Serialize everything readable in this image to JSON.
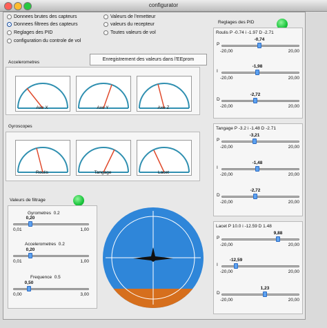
{
  "window": {
    "title": "configurator"
  },
  "modes": [
    {
      "label": "Donnees brutes des capteurs",
      "selected": false
    },
    {
      "label": "Donnees filtrees des capteurs",
      "selected": true
    },
    {
      "label": "Reglages des PID",
      "selected": false
    },
    {
      "label": "configuration du controle de vol",
      "selected": false
    }
  ],
  "modes_right": [
    {
      "label": "Valeurs de l'emetteur",
      "selected": false
    },
    {
      "label": "valeurs du recepteur",
      "selected": false
    },
    {
      "label": "Toutes valeurs de vol",
      "selected": false
    }
  ],
  "eeprom_button": "Enregistrement des valeurs dans l'EEprom",
  "accel": {
    "title": "Accelerometres",
    "axes": [
      "Axe X",
      "Axe Y",
      "Axe Z"
    ]
  },
  "gyro": {
    "title": "Gyroscopes",
    "axes": [
      "Roulis",
      "Tangage",
      "Lacet"
    ]
  },
  "filter": {
    "title": "Valeurs de filtrage",
    "items": [
      {
        "name": "Gyrometres",
        "current": "0.2",
        "value": "0,20",
        "min": "0,01",
        "max": "1,00"
      },
      {
        "name": "Accelerometres",
        "current": "0.2",
        "value": "0,20",
        "min": "0,01",
        "max": "1,00"
      },
      {
        "name": "Frequence",
        "current": "0.5",
        "value": "0,50",
        "min": "0,00",
        "max": "3,00"
      }
    ]
  },
  "pid": {
    "title": "Reglages des PID",
    "groups": [
      {
        "header": "Roulis  P -0.74  i -1.97  D -2.71",
        "rows": [
          {
            "letter": "P",
            "value": "-0,74",
            "min": "-20,00",
            "max": "20,00"
          },
          {
            "letter": "I",
            "value": "-1,98",
            "min": "-20,00",
            "max": "20,00"
          },
          {
            "letter": "D",
            "value": "-2,72",
            "min": "-20,00",
            "max": "20,00"
          }
        ]
      },
      {
        "header": "Tangage  P -3.2  i -1.48  D -2.71",
        "rows": [
          {
            "letter": "P",
            "value": "-3,21",
            "min": "-20,00",
            "max": "20,00"
          },
          {
            "letter": "I",
            "value": "-1,48",
            "min": "-20,00",
            "max": "20,00"
          },
          {
            "letter": "D",
            "value": "-2,72",
            "min": "-20,00",
            "max": "20,00"
          }
        ]
      },
      {
        "header": "Lacet  P 10.0  i -12.59  D 1.48",
        "rows": [
          {
            "letter": "P",
            "value": "9,88",
            "min": "-20,00",
            "max": "20,00"
          },
          {
            "letter": "I",
            "value": "-12,59",
            "min": "-20,00",
            "max": "20,00"
          },
          {
            "letter": "D",
            "value": "1,23",
            "min": "-20,00",
            "max": "20,00"
          }
        ]
      }
    ]
  },
  "colors": {
    "led": "#19c43b",
    "sky": "#2f86d9",
    "ground": "#d66f1d"
  }
}
